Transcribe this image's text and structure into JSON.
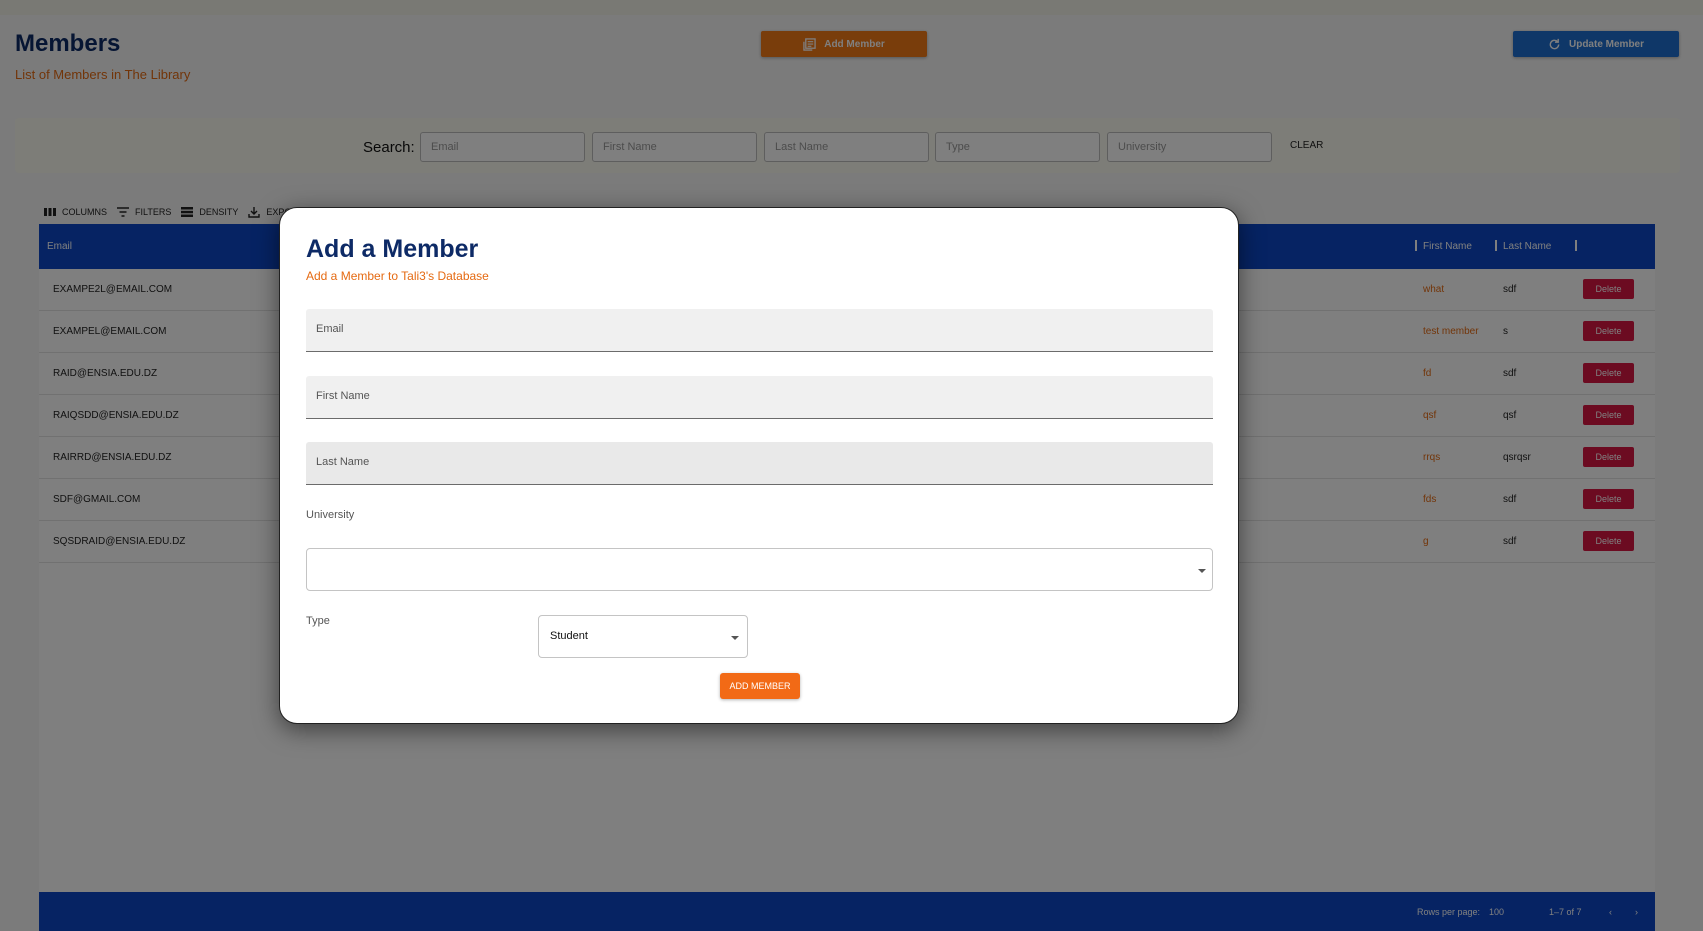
{
  "header": {
    "title": "Members",
    "subtitle": "List of Members in The Library",
    "add_button": "Add Member",
    "update_button": "Update Member"
  },
  "search": {
    "label": "Search:",
    "fields": [
      "Email",
      "First Name",
      "Last Name",
      "Type",
      "University"
    ],
    "clear_label": "CLEAR"
  },
  "toolbar": {
    "columns": "COLUMNS",
    "filters": "FILTERS",
    "density": "DENSITY",
    "export": "EXPORT"
  },
  "table": {
    "headers": {
      "email": "Email",
      "first_name": "First Name",
      "last_name": "Last Name"
    },
    "delete_label": "Delete",
    "rows": [
      {
        "email": "EXAMPE2L@EMAIL.COM",
        "first_name": "what",
        "last_name": "sdf"
      },
      {
        "email": "EXAMPEL@EMAIL.COM",
        "first_name": "test member",
        "last_name": "s"
      },
      {
        "email": "RAID@ENSIA.EDU.DZ",
        "first_name": "fd",
        "last_name": "sdf"
      },
      {
        "email": "RAIQSDD@ENSIA.EDU.DZ",
        "first_name": "qsf",
        "last_name": "qsf"
      },
      {
        "email": "RAIRRD@ENSIA.EDU.DZ",
        "first_name": "rrqs",
        "last_name": "qsrqsr"
      },
      {
        "email": "SDF@GMAIL.COM",
        "first_name": "fds",
        "last_name": "sdf"
      },
      {
        "email": "SQSDRAID@ENSIA.EDU.DZ",
        "first_name": "g",
        "last_name": "sdf"
      }
    ],
    "footer": {
      "rows_per_page_label": "Rows per page:",
      "rows_per_page": "100",
      "range": "1–7 of 7"
    }
  },
  "modal": {
    "title": "Add a Member",
    "subtitle": "Add a Member to Tali3's Database",
    "email_label": "Email",
    "first_name_label": "First Name",
    "last_name_label": "Last Name",
    "university_label": "University",
    "university_value": "",
    "type_label": "Type",
    "type_value": "Student",
    "submit_label": "ADD MEMBER"
  },
  "colors": {
    "accent": "#f27a16",
    "primary": "#0d47c6",
    "title": "#0d2a66",
    "danger": "#d91743"
  }
}
